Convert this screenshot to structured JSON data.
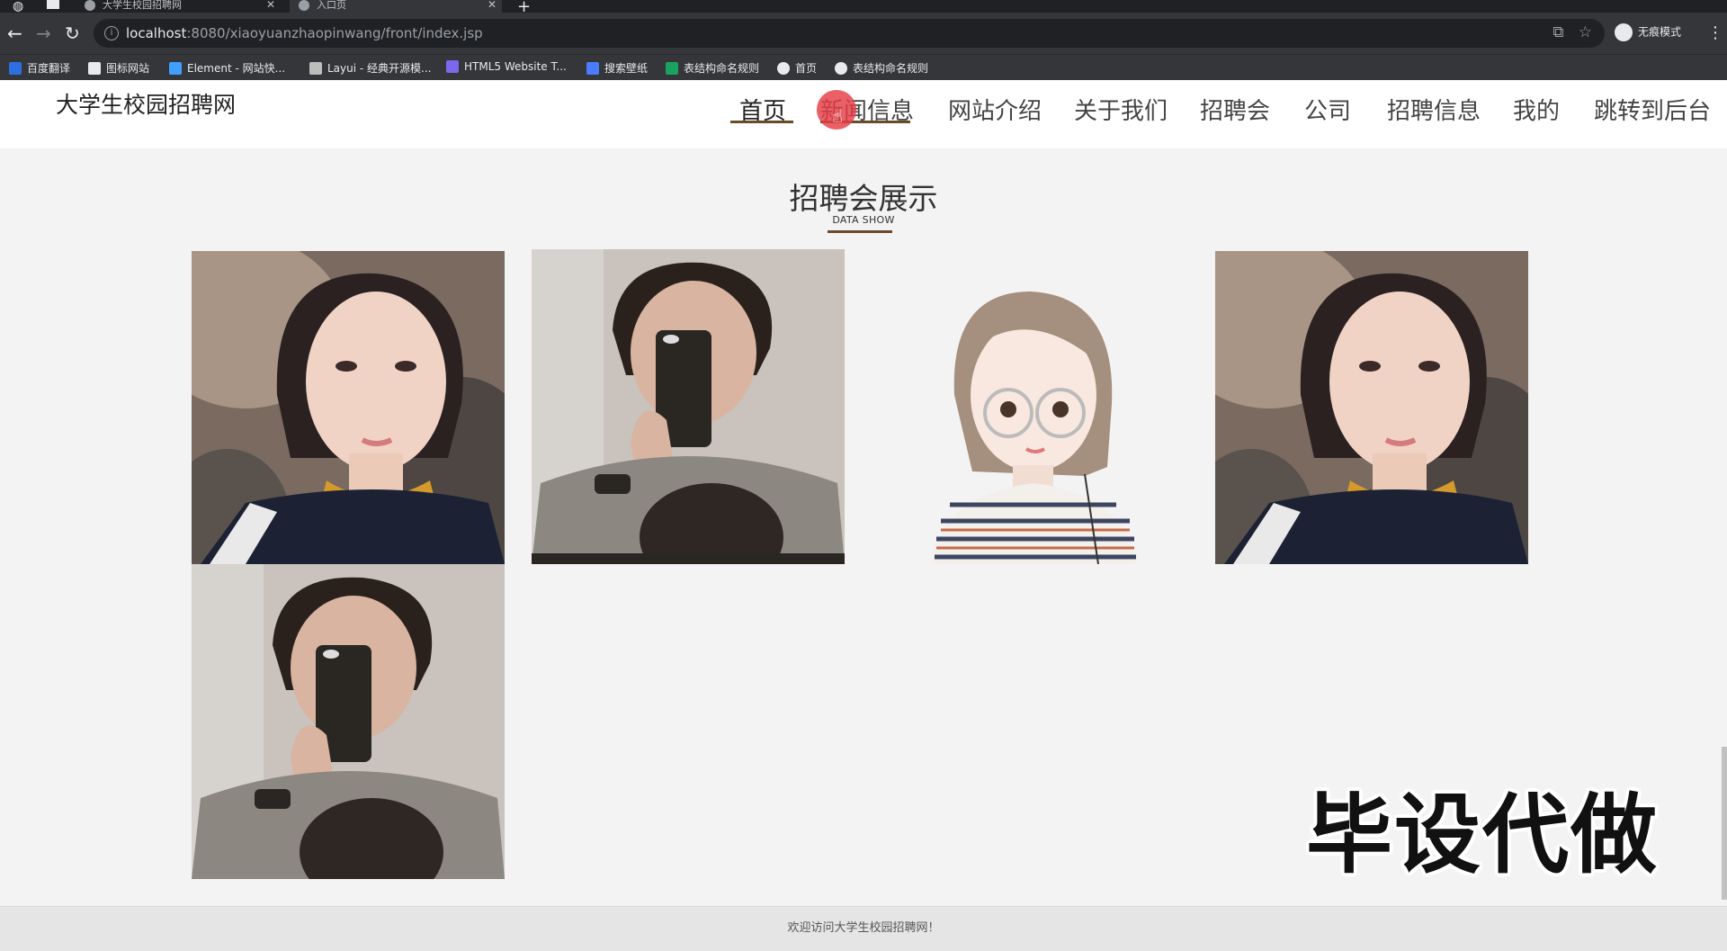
{
  "browser": {
    "tabs": [
      {
        "title": "大学生校园招聘网",
        "active": false
      },
      {
        "title": "入口页",
        "active": true
      }
    ],
    "url_host": "localhost",
    "url_rest": ":8080/xiaoyuanzhaopinwang/front/index.jsp",
    "profile_label": "无痕模式",
    "bookmarks": [
      {
        "label": "百度翻译",
        "color": "#2d6fe0"
      },
      {
        "label": "图标网站",
        "color": "#e8eaed"
      },
      {
        "label": "Element - 网站快...",
        "color": "#409eff"
      },
      {
        "label": "Layui - 经典开源模...",
        "color": "#bdbdbd"
      },
      {
        "label": "HTML5 Website T...",
        "color": "#7b68ee"
      },
      {
        "label": "搜索壁纸",
        "color": "#4a7cff"
      },
      {
        "label": "表结构命名规则",
        "color": "#1aa260"
      },
      {
        "label": "首页",
        "color": "#e8eaed"
      },
      {
        "label": "表结构命名规则",
        "color": "#e8eaed"
      }
    ]
  },
  "site": {
    "logo": "大学生校园招聘网",
    "nav": [
      {
        "label": "首页",
        "active": true
      },
      {
        "label": "新闻信息",
        "active": false
      },
      {
        "label": "网站介绍",
        "active": false
      },
      {
        "label": "关于我们",
        "active": false
      },
      {
        "label": "招聘会",
        "active": false
      },
      {
        "label": "公司",
        "active": false
      },
      {
        "label": "招聘信息",
        "active": false
      },
      {
        "label": "我的",
        "active": false
      },
      {
        "label": "跳转到后台",
        "active": false
      }
    ],
    "accent_color": "#6b4a2a"
  },
  "section": {
    "title": "招聘会展示",
    "subtitle": "DATA SHOW",
    "items": [
      {
        "image": "girl-photo-icon"
      },
      {
        "image": "boy-mirror-selfie-icon"
      },
      {
        "image": "cartoon-girl-icon"
      },
      {
        "image": "girl-photo-icon"
      },
      {
        "image": "boy-mirror-selfie-icon"
      }
    ]
  },
  "watermark": "毕设代做",
  "footer": {
    "text": "欢迎访问大学生校园招聘网！"
  }
}
